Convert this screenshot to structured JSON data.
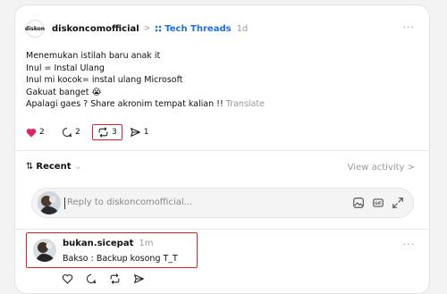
{
  "post": {
    "username": "diskoncomofficial",
    "avatar_text": "diskon",
    "separator": ">",
    "topic": "Tech Threads",
    "time": "1d",
    "more": "···",
    "lines": [
      "Menemukan istilah baru anak it",
      "Inul = Instal Ulang",
      "Inul mi kocok= instal ulang Microsoft",
      "Gakuat banget 😭",
      "Apalagi gaes ? Share akronim tempat kalian !!"
    ],
    "translate": "Translate",
    "actions": {
      "likes": "2",
      "comments": "2",
      "reposts": "3",
      "shares": "1"
    }
  },
  "replies_header": {
    "sort_label": "Recent",
    "view_activity": "View activity >"
  },
  "reply_box": {
    "placeholder": "Reply to diskoncomofficial..."
  },
  "reply": {
    "username": "bukan.sicepat",
    "time": "1m",
    "text": "Bakso : Backup kosong T_T",
    "more": "···"
  },
  "colors": {
    "accent": "#1d6fe0",
    "like": "#e0245e",
    "highlight": "#e02020"
  }
}
